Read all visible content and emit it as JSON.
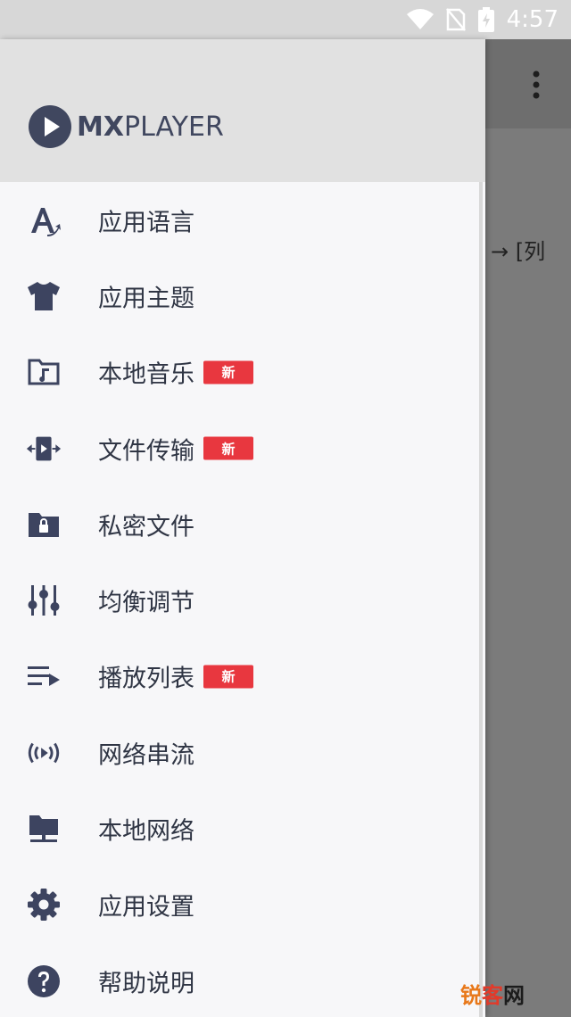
{
  "status_bar": {
    "time": "4:57",
    "icons": [
      "wifi-icon",
      "no-sim-icon",
      "battery-charging-icon"
    ]
  },
  "app": {
    "logo_mx": "MX",
    "logo_player": "PLAYER"
  },
  "background": {
    "hint": "→ [列",
    "arrow": "›"
  },
  "menu": {
    "items": [
      {
        "label": "应用语言",
        "icon": "language-icon",
        "badge": ""
      },
      {
        "label": "应用主题",
        "icon": "theme-shirt-icon",
        "badge": ""
      },
      {
        "label": "本地音乐",
        "icon": "music-folder-icon",
        "badge": "新"
      },
      {
        "label": "文件传输",
        "icon": "file-transfer-icon",
        "badge": "新"
      },
      {
        "label": "私密文件",
        "icon": "private-folder-icon",
        "badge": ""
      },
      {
        "label": "均衡调节",
        "icon": "equalizer-icon",
        "badge": ""
      },
      {
        "label": "播放列表",
        "icon": "playlist-icon",
        "badge": "新"
      },
      {
        "label": "网络串流",
        "icon": "stream-icon",
        "badge": ""
      },
      {
        "label": "本地网络",
        "icon": "local-network-icon",
        "badge": ""
      },
      {
        "label": "应用设置",
        "icon": "settings-gear-icon",
        "badge": ""
      },
      {
        "label": "帮助说明",
        "icon": "help-icon",
        "badge": ""
      }
    ]
  },
  "watermark": {
    "part1": "锐",
    "part2": "客",
    "part3": "网"
  },
  "colors": {
    "icon": "#3d4460",
    "badge": "#e8373f",
    "header": "#e1e1e1",
    "drawer": "#f7f7f9"
  }
}
